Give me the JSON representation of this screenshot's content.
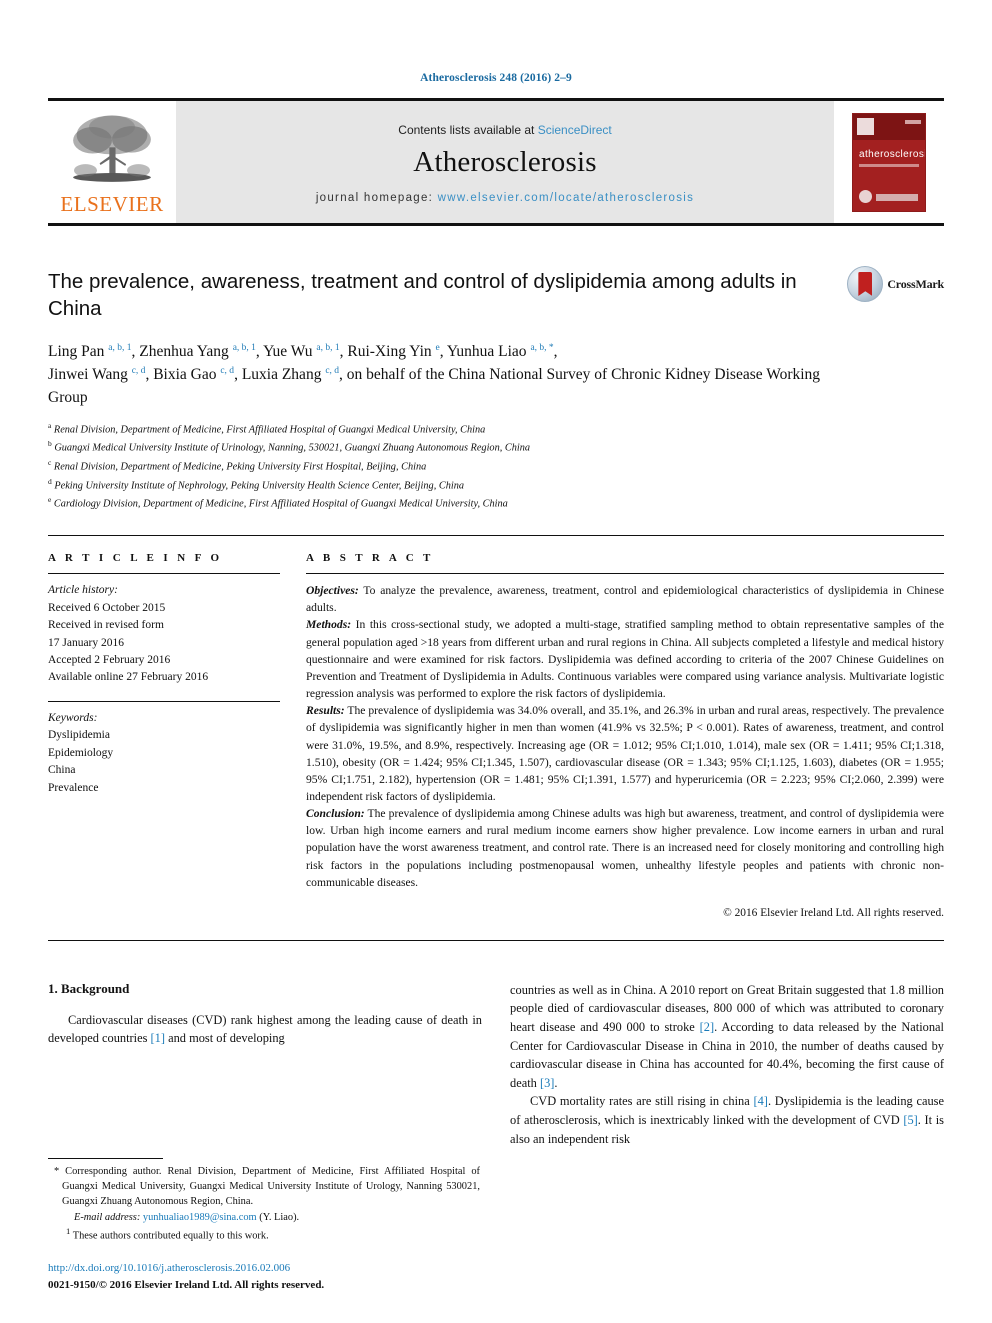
{
  "running_head": "Atherosclerosis 248 (2016) 2–9",
  "masthead": {
    "publisher_logo_word": "ELSEVIER",
    "contents_prefix": "Contents lists available at ",
    "contents_link": "ScienceDirect",
    "journal_name": "Atherosclerosis",
    "homepage_prefix": "journal homepage: ",
    "homepage_url": "www.elsevier.com/locate/atherosclerosis",
    "cover_title": "atherosclerosis"
  },
  "crossmark": {
    "label": "CrossMark"
  },
  "article": {
    "title": "The prevalence, awareness, treatment and control of dyslipidemia among adults in China",
    "authors_line_1": "Ling Pan <sup>a, b, 1</sup>, Zhenhua Yang <sup>a, b, 1</sup>, Yue Wu <sup>a, b, 1</sup>, Rui-Xing Yin <sup>e</sup>, Yunhua Liao <sup>a, b, *</sup>,",
    "authors_line_2": "Jinwei Wang <sup>c, d</sup>, Bixia Gao <sup>c, d</sup>, Luxia Zhang <sup>c, d</sup>, on behalf of the China National Survey of Chronic Kidney Disease Working Group",
    "affiliations": [
      {
        "mark": "a",
        "text": "Renal Division, Department of Medicine, First Affiliated Hospital of Guangxi Medical University, China"
      },
      {
        "mark": "b",
        "text": "Guangxi Medical University Institute of Urinology, Nanning, 530021, Guangxi Zhuang Autonomous Region, China"
      },
      {
        "mark": "c",
        "text": "Renal Division, Department of Medicine, Peking University First Hospital, Beijing, China"
      },
      {
        "mark": "d",
        "text": "Peking University Institute of Nephrology, Peking University Health Science Center, Beijing, China"
      },
      {
        "mark": "e",
        "text": "Cardiology Division, Department of Medicine, First Affiliated Hospital of Guangxi Medical University, China"
      }
    ]
  },
  "article_info": {
    "heading": "A R T I C L E  I N F O",
    "history_label": "Article history:",
    "history": [
      "Received 6 October 2015",
      "Received in revised form",
      "17 January 2016",
      "Accepted 2 February 2016",
      "Available online 27 February 2016"
    ],
    "keywords_label": "Keywords:",
    "keywords": [
      "Dyslipidemia",
      "Epidemiology",
      "China",
      "Prevalence"
    ]
  },
  "abstract": {
    "heading": "A B S T R A C T",
    "objectives_label": "Objectives:",
    "objectives_text": " To analyze the prevalence, awareness, treatment, control and epidemiological characteristics of dyslipidemia in Chinese adults.",
    "methods_label": "Methods:",
    "methods_text": " In this cross-sectional study, we adopted a multi-stage, stratified sampling method to obtain representative samples of the general population aged >18 years from different urban and rural regions in China. All subjects completed a lifestyle and medical history questionnaire and were examined for risk factors. Dyslipidemia was defined according to criteria of the 2007 Chinese Guidelines on Prevention and Treatment of Dyslipidemia in Adults. Continuous variables were compared using variance analysis. Multivariate logistic regression analysis was performed to explore the risk factors of dyslipidemia.",
    "results_label": "Results:",
    "results_text": " The prevalence of dyslipidemia was 34.0% overall, and 35.1%, and 26.3% in urban and rural areas, respectively. The prevalence of dyslipidemia was significantly higher in men than women (41.9% vs 32.5%; P < 0.001). Rates of awareness, treatment, and control were 31.0%, 19.5%, and 8.9%, respectively. Increasing age (OR = 1.012; 95% CI;1.010, 1.014), male sex (OR = 1.411; 95% CI;1.318, 1.510), obesity (OR = 1.424; 95% CI;1.345, 1.507), cardiovascular disease (OR = 1.343; 95% CI;1.125, 1.603), diabetes (OR = 1.955; 95% CI;1.751, 2.182), hypertension (OR = 1.481; 95% CI;1.391, 1.577) and hyperuricemia (OR = 2.223; 95% CI;2.060, 2.399) were independent risk factors of dyslipidemia.",
    "conclusion_label": "Conclusion:",
    "conclusion_text": " The prevalence of dyslipidemia among Chinese adults was high but awareness, treatment, and control of dyslipidemia were low. Urban high income earners and rural medium income earners show higher prevalence. Low income earners in urban and rural population have the worst awareness treatment, and control rate. There is an increased need for closely monitoring and controlling high risk factors in the populations including postmenopausal women, unhealthy lifestyle peoples and patients with chronic non-communicable diseases.",
    "copyright": "© 2016 Elsevier Ireland Ltd. All rights reserved."
  },
  "body": {
    "section_heading": "1. Background",
    "left_paragraph": "Cardiovascular diseases (CVD) rank highest among the leading cause of death in developed countries [1] and most of developing",
    "right_paragraph_1": "countries as well as in China. A 2010 report on Great Britain suggested that 1.8 million people died of cardiovascular diseases, 800 000 of which was attributed to coronary heart disease and 490 000 to stroke [2]. According to data released by the National Center for Cardiovascular Disease in China in 2010, the number of deaths caused by cardiovascular disease in China has accounted for 40.4%, becoming the first cause of death [3].",
    "right_paragraph_2": "CVD mortality rates are still rising in china [4]. Dyslipidemia is the leading cause of atherosclerosis, which is inextricably linked with the development of CVD [5]. It is also an independent risk"
  },
  "footnotes": {
    "corresponding_mark": "*",
    "corresponding_text": " Corresponding author. Renal Division, Department of Medicine, First Affiliated Hospital of Guangxi Medical University, Guangxi Medical University Institute of Urology, Nanning 530021, Guangxi Zhuang Autonomous Region, China.",
    "email_label": "E-mail address:",
    "email": "yunhualiao1989@sina.com",
    "email_suffix": " (Y. Liao).",
    "equal_mark": "1",
    "equal_text": " These authors contributed equally to this work.",
    "doi": "http://dx.doi.org/10.1016/j.atherosclerosis.2016.02.006",
    "issn_line": "0021-9150/© 2016 Elsevier Ireland Ltd. All rights reserved."
  },
  "colors": {
    "link": "#1a7bb9",
    "running_head": "#1a6aa0",
    "elsevier_orange": "#E9711C",
    "cover_red": "#a32020",
    "masthead_gray": "#e6e6e6"
  }
}
